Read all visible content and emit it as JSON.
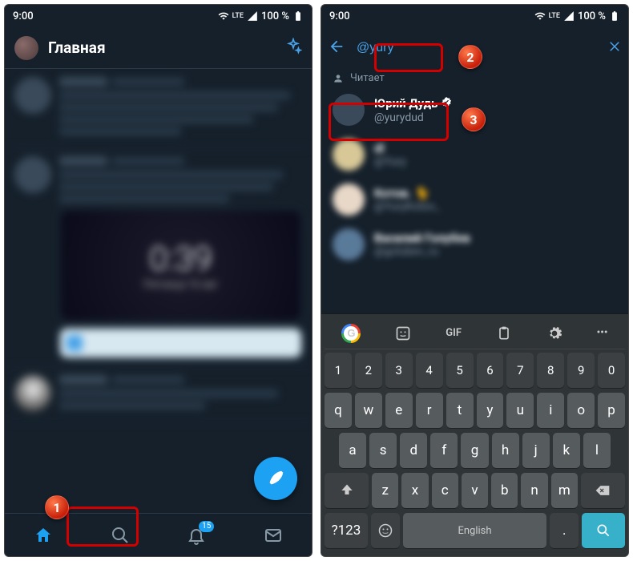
{
  "statusbar": {
    "time": "9:00",
    "net": "LTE",
    "battery": "100 %"
  },
  "left": {
    "title": "Главная",
    "clock": {
      "time": "0:39",
      "subtitle": "Пятница 16 авг"
    },
    "nav_badge": "15"
  },
  "right": {
    "search": {
      "query": "@yury"
    },
    "section_label": "Читает",
    "results": [
      {
        "name": "Юрий Дудь",
        "handle": "@yurydud",
        "verified": true
      },
      {
        "name": "dl",
        "handle": "@Yury",
        "verified": false
      },
      {
        "name": "Котов.",
        "handle": "@YuryKotov_",
        "verified": false
      },
      {
        "name": "Василий Голубев",
        "handle": "@golubev_ru",
        "verified": false
      }
    ]
  },
  "keyboard": {
    "top_gif": "GIF",
    "row_num": [
      "1",
      "2",
      "3",
      "4",
      "5",
      "6",
      "7",
      "8",
      "9",
      "0"
    ],
    "row_q": [
      "q",
      "w",
      "e",
      "r",
      "t",
      "y",
      "u",
      "i",
      "o",
      "p"
    ],
    "row_a": [
      "a",
      "s",
      "d",
      "f",
      "g",
      "h",
      "j",
      "k",
      "l"
    ],
    "row_z": [
      "z",
      "x",
      "c",
      "v",
      "b",
      "n",
      "m"
    ],
    "sym": "?123",
    "space": "English",
    "dot": "."
  },
  "annotations": {
    "step1": "1",
    "step2": "2",
    "step3": "3"
  }
}
